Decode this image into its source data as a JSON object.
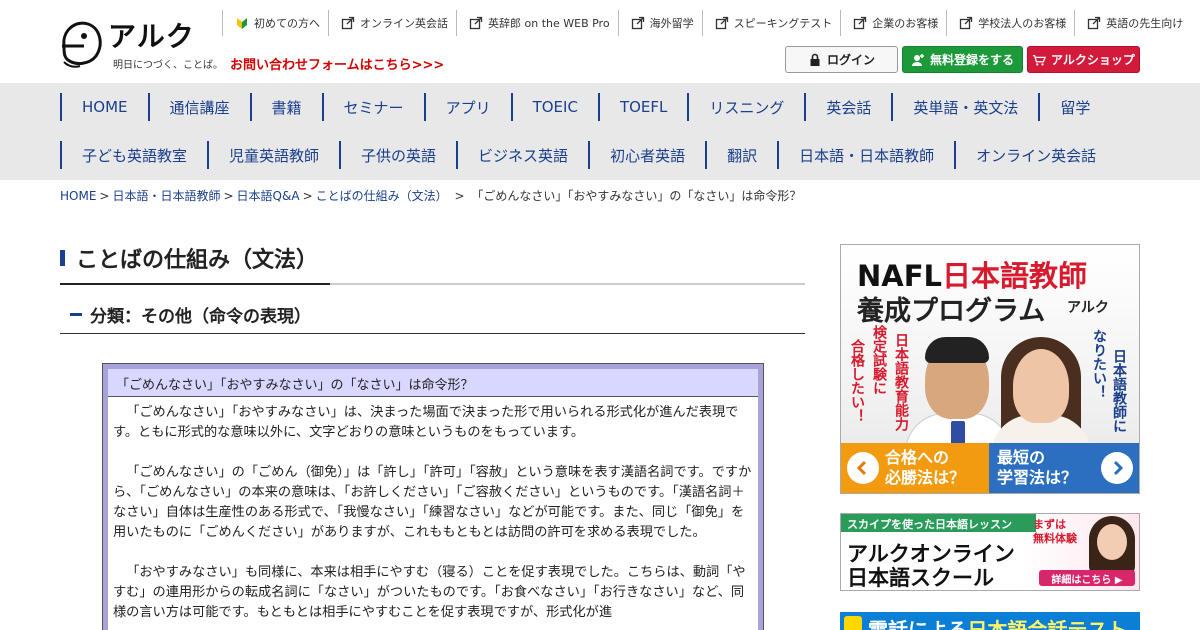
{
  "header": {
    "logo_text": "アルク",
    "logo_tagline": "明日につづく、ことば。",
    "contact_link": "お問い合わせフォームはこちら>>>",
    "top_links": [
      {
        "label": "初めての方へ",
        "icon": "beginner-leaf-icon"
      },
      {
        "label": "オンライン英会話",
        "icon": "external-link-icon"
      },
      {
        "label": "英辞郎 on the WEB Pro",
        "icon": "external-link-icon"
      },
      {
        "label": "海外留学",
        "icon": "external-link-icon"
      },
      {
        "label": "スピーキングテスト",
        "icon": "external-link-icon"
      },
      {
        "label": "企業のお客様",
        "icon": "external-link-icon"
      },
      {
        "label": "学校法人のお客様",
        "icon": "external-link-icon"
      },
      {
        "label": "英語の先生向け",
        "icon": "external-link-icon"
      }
    ],
    "login_label": "ログイン",
    "signup_label": "無料登録をする",
    "shop_label": "アルクショップ"
  },
  "nav": {
    "row1": [
      "HOME",
      "通信講座",
      "書籍",
      "セミナー",
      "アプリ",
      "TOEIC",
      "TOEFL",
      "リスニング",
      "英会話",
      "英単語・英文法",
      "留学"
    ],
    "row2": [
      "子ども英語教室",
      "児童英語教師",
      "子供の英語",
      "ビジネス英語",
      "初心者英語",
      "翻訳",
      "日本語・日本語教師",
      "オンライン英会話"
    ]
  },
  "breadcrumb": {
    "items": [
      "HOME",
      "日本語・日本語教師",
      "日本語Q&A",
      "ことばの仕組み（文法）"
    ],
    "current": "「ごめんなさい」「おやすみなさい」の「なさい」は命令形？"
  },
  "main": {
    "page_title": "ことばの仕組み（文法）",
    "subheading": "分類：その他（命令の表現）",
    "qa_title": "「ごめんなさい」「おやすみなさい」の「なさい」は命令形？",
    "paragraphs": [
      "「ごめんなさい」「おやすみなさい」は、決まった場面で決まった形で用いられる形式化が進んだ表現です。ともに形式的な意味以外に、文字どおりの意味というものをもっています。",
      "「ごめんなさい」の「ごめん（御免）」は「許し」「許可」「容赦」という意味を表す漢語名詞です。ですから、「ごめんなさい」の本来の意味は、「お許しください」「ご容赦ください」というものです。「漢語名詞＋なさい」自体は生産性のある形式で、「我慢なさい」「練習なさい」などが可能です。また、同じ「御免」を用いたものに「ごめんください」がありますが、これももともとは訪問の許可を求める表現でした。",
      "「おやすみなさい」も同様に、本来は相手にやすむ（寝る）ことを促す表現でした。こちらは、動詞「やすむ」の連用形からの転成名詞に「なさい」がついたものです。「お食べなさい」「お行きなさい」など、同様の言い方は可能です。もともとは相手にやすむことを促す表現ですが、形式化が進"
    ]
  },
  "sidebar": {
    "banner1": {
      "line1_black": "NAFL",
      "line1_red": "日本語教師",
      "line2": "養成プログラム",
      "logo": "アルク",
      "left_vertical": [
        "合格したい！",
        "検定試験に",
        "日本語教育能力"
      ],
      "right_vertical": [
        "なりたい！",
        "日本語教師に"
      ],
      "cta_left": [
        "合格への",
        "必勝法は？"
      ],
      "cta_right": [
        "最短の",
        "学習法は？"
      ]
    },
    "banner2": {
      "top": "スカイプを使った日本語レッスン",
      "free1": "まずは",
      "free2": "無料体験",
      "line1": "アルクオンライン",
      "line2": "日本語スクール",
      "detail": "詳細はこちら ▶"
    },
    "banner3": {
      "text_white": "電話による",
      "text_yellow": "日本語会話テスト"
    }
  },
  "colors": {
    "nav_bg": "#e8e8e8",
    "nav_text": "#1a3f8c",
    "accent_red": "#d40000",
    "signup_green": "#1c9a3a",
    "shop_red": "#d31a3a",
    "qa_header_bg": "#d9d7ff",
    "qa_border": "#a7a2d9"
  }
}
